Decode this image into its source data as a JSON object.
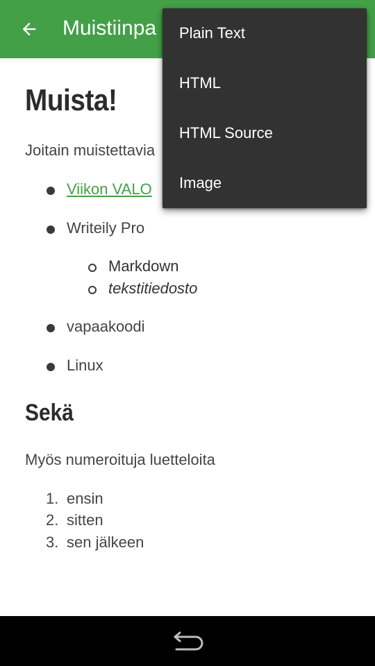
{
  "app_bar": {
    "title": "Muistiinpa",
    "back_icon": "arrow-back-icon",
    "color": "#43a047"
  },
  "document": {
    "heading": "Muista!",
    "intro": "Joitain muistettavia",
    "bullets": [
      {
        "text": "Viikon VALO",
        "is_link": true
      },
      {
        "text": "Writeily Pro"
      },
      {
        "text": "vapaakoodi"
      },
      {
        "text": "Linux"
      }
    ],
    "sub_bullets": [
      {
        "text": "Markdown"
      },
      {
        "text": "tekstitiedosto",
        "italic": true
      }
    ],
    "subheading": "Sekä",
    "paragraph2": "Myös numeroituja luetteloita",
    "ordered": [
      {
        "num": "1.",
        "text": "ensin"
      },
      {
        "num": "2.",
        "text": "sitten"
      },
      {
        "num": "3.",
        "text": "sen jälkeen"
      }
    ],
    "link_color": "#43a047"
  },
  "menu": {
    "items": [
      {
        "label": "Plain Text"
      },
      {
        "label": "HTML"
      },
      {
        "label": "HTML Source"
      },
      {
        "label": "Image"
      }
    ],
    "background": "#323232"
  },
  "nav_bar": {
    "back_icon": "nav-back-icon"
  }
}
